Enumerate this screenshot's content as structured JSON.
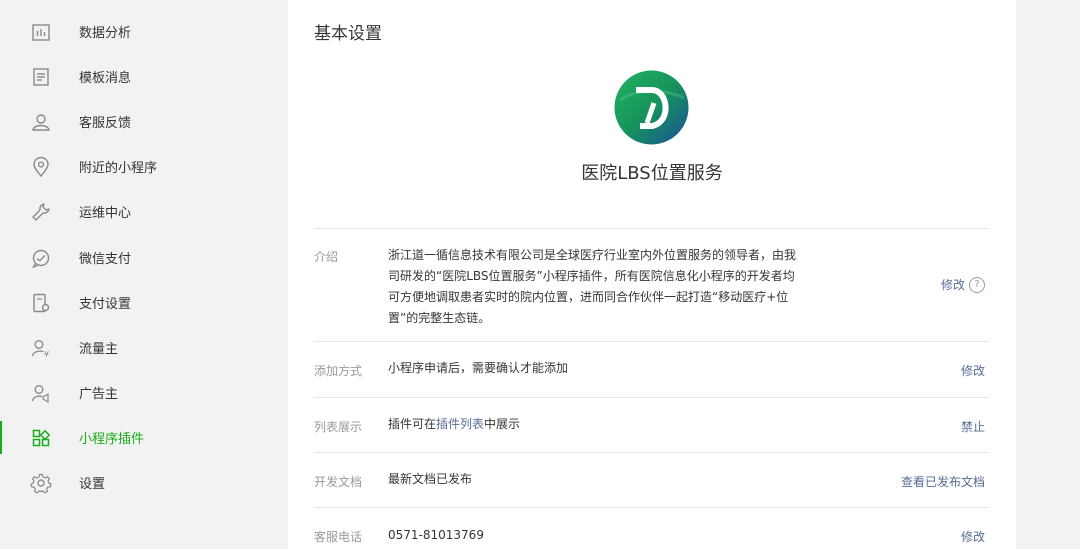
{
  "sidebar": {
    "items": [
      {
        "label": "数据分析",
        "icon": "chart-icon"
      },
      {
        "label": "模板消息",
        "icon": "document-icon"
      },
      {
        "label": "客服反馈",
        "icon": "person-icon"
      },
      {
        "label": "附近的小程序",
        "icon": "location-pin-icon"
      },
      {
        "label": "运维中心",
        "icon": "wrench-icon"
      },
      {
        "label": "微信支付",
        "icon": "chat-bubble-icon"
      },
      {
        "label": "支付设置",
        "icon": "phone-settings-icon"
      },
      {
        "label": "流量主",
        "icon": "person-yen-icon"
      },
      {
        "label": "广告主",
        "icon": "person-megaphone-icon"
      },
      {
        "label": "小程序插件",
        "icon": "grid-plugin-icon",
        "active": true
      },
      {
        "label": "设置",
        "icon": "gear-icon"
      }
    ]
  },
  "main": {
    "title": "基本设置",
    "app_name": "医院LBS位置服务",
    "logo_letter": "D",
    "rows": {
      "intro": {
        "label": "介绍",
        "lines": [
          "浙江道一循信息技术有限公司是全球医疗行业室内外位置服务的领导者，由我",
          "司研发的“医院LBS位置服务”小程序插件，所有医院信息化小程序的开发者均",
          "可方便地调取患者实时的院内位置，进而同合作伙伴一起打造“移动医疗+位",
          "置”的完整生态链。"
        ],
        "action": "修改",
        "help": "?"
      },
      "add_method": {
        "label": "添加方式",
        "value": "小程序申请后，需要确认才能添加",
        "action": "修改"
      },
      "list_display": {
        "label": "列表展示",
        "value_pre": "插件可在",
        "value_link": "插件列表",
        "value_post": "中展示",
        "action": "禁止"
      },
      "dev_docs": {
        "label": "开发文档",
        "value": "最新文档已发布",
        "action": "查看已发布文档"
      },
      "phone": {
        "label": "客服电话",
        "value": "0571-81013769",
        "action": "修改"
      }
    }
  },
  "colors": {
    "accent": "#1aad19",
    "link": "#576b95",
    "logo_gradient": [
      "#1e9e5a",
      "#1a5f9e"
    ]
  }
}
